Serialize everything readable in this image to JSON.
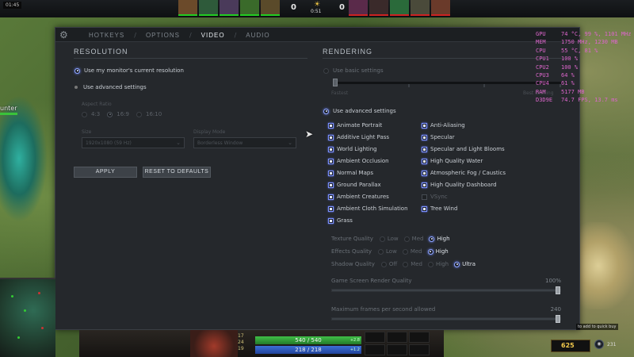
{
  "topbar": {
    "clock": "01:45",
    "score_radiant": "0",
    "score_dire": "0",
    "game_time": "0:51"
  },
  "world": {
    "hero_label": "unter"
  },
  "panel": {
    "tabs": [
      {
        "label": "HOTKEYS",
        "active": false
      },
      {
        "label": "OPTIONS",
        "active": false
      },
      {
        "label": "VIDEO",
        "active": true
      },
      {
        "label": "AUDIO",
        "active": false
      }
    ],
    "resolution": {
      "title": "RESOLUTION",
      "use_monitor": "Use my monitor's current resolution",
      "use_advanced": "Use advanced settings",
      "aspect_ratio_label": "Aspect Ratio",
      "aspect_options": [
        "4:3",
        "16:9",
        "16:10"
      ],
      "size_label": "Size",
      "size_value": "1920x1080 (59 Hz)",
      "display_mode_label": "Display Mode",
      "display_mode_value": "Borderless Window",
      "apply": "APPLY",
      "reset": "RESET TO DEFAULTS"
    },
    "rendering": {
      "title": "RENDERING",
      "use_basic": "Use basic settings",
      "basic_left": "Fastest",
      "basic_right": "Best Looking",
      "use_advanced": "Use advanced settings",
      "left_checks": [
        {
          "label": "Animate Portrait",
          "on": true
        },
        {
          "label": "Additive Light Pass",
          "on": true
        },
        {
          "label": "World Lighting",
          "on": true
        },
        {
          "label": "Ambient Occlusion",
          "on": true
        },
        {
          "label": "Normal Maps",
          "on": true
        },
        {
          "label": "Ground Parallax",
          "on": true
        },
        {
          "label": "Ambient Creatures",
          "on": true
        },
        {
          "label": "Ambient Cloth Simulation",
          "on": true
        },
        {
          "label": "Grass",
          "on": true
        }
      ],
      "right_checks": [
        {
          "label": "Anti-Aliasing",
          "on": true
        },
        {
          "label": "Specular",
          "on": true
        },
        {
          "label": "Specular and Light Blooms",
          "on": true
        },
        {
          "label": "High Quality Water",
          "on": true
        },
        {
          "label": "Atmospheric Fog / Caustics",
          "on": true
        },
        {
          "label": "High Quality Dashboard",
          "on": true
        },
        {
          "label": "VSync",
          "on": false
        },
        {
          "label": "Tree Wind",
          "on": true
        }
      ],
      "texture_quality": {
        "label": "Texture Quality",
        "options": [
          "Low",
          "Med",
          "High"
        ],
        "selected": "High"
      },
      "effects_quality": {
        "label": "Effects Quality",
        "options": [
          "Low",
          "Med",
          "High"
        ],
        "selected": "High"
      },
      "shadow_quality": {
        "label": "Shadow Quality",
        "options": [
          "Off",
          "Med",
          "High",
          "Ultra"
        ],
        "selected": "Ultra"
      },
      "render_quality": {
        "label": "Game Screen Render Quality",
        "value_text": "100%",
        "fraction": 1.0
      },
      "max_fps": {
        "label": "Maximum frames per second allowed",
        "value_text": "240",
        "fraction": 1.0
      }
    }
  },
  "stats": [
    {
      "key": "GPU",
      "value": "74 °C, 99 %, 1101 MHz"
    },
    {
      "key": "MEM",
      "value": "1750 MHz, 1230 MB"
    },
    {
      "key": "CPU",
      "value": "55 °C, 81 %"
    },
    {
      "key": "CPU1",
      "value": "100 %"
    },
    {
      "key": "CPU2",
      "value": "100 %"
    },
    {
      "key": "CPU3",
      "value": "64 %"
    },
    {
      "key": "CPU4",
      "value": "61 %"
    },
    {
      "key": "RAM",
      "value": "5177 MB"
    },
    {
      "key": "D3D9E",
      "value": "74.7 FPS, 13.7 ms"
    }
  ],
  "hud": {
    "hp_text": "540 / 540",
    "hp_regen": "+2.8",
    "mana_text": "218 / 218",
    "mana_regen": "+1.2",
    "level_stats": [
      "17",
      "24",
      "19"
    ],
    "gold": "625",
    "quickbuy_tip": "to add to quick buy",
    "courier_count": "231"
  },
  "colors": {
    "accent": "#8fa6ff",
    "stats_text": "#dd66cc",
    "gold": "#f2c94c"
  }
}
